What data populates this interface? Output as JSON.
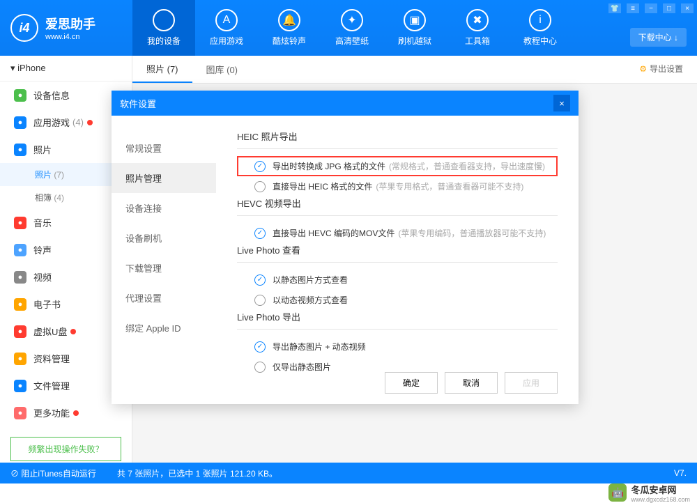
{
  "app": {
    "title": "爱思助手",
    "url": "www.i4.cn"
  },
  "nav": [
    {
      "label": "我的设备"
    },
    {
      "label": "应用游戏"
    },
    {
      "label": "酷炫铃声"
    },
    {
      "label": "高清壁纸"
    },
    {
      "label": "刷机越狱"
    },
    {
      "label": "工具箱"
    },
    {
      "label": "教程中心"
    }
  ],
  "download_center": "下载中心 ↓",
  "device": "iPhone",
  "sidebar": [
    {
      "label": "设备信息",
      "color": "#4cbf4c"
    },
    {
      "label": "应用游戏",
      "count": "(4)",
      "color": "#0a84ff",
      "dot": true
    },
    {
      "label": "照片",
      "color": "#0a84ff",
      "subs": [
        {
          "label": "照片",
          "count": "(7)",
          "active": true
        },
        {
          "label": "相簿",
          "count": "(4)"
        }
      ]
    },
    {
      "label": "音乐",
      "color": "#ff3b30"
    },
    {
      "label": "铃声",
      "color": "#4da3ff"
    },
    {
      "label": "视频",
      "color": "#888"
    },
    {
      "label": "电子书",
      "color": "#ffa500"
    },
    {
      "label": "虚拟U盘",
      "color": "#ff3b30",
      "dot": true
    },
    {
      "label": "资料管理",
      "color": "#ffa500"
    },
    {
      "label": "文件管理",
      "color": "#0a84ff"
    },
    {
      "label": "更多功能",
      "color": "#ff6b6b",
      "dot": true
    }
  ],
  "help": "频繁出现操作失败？",
  "tabs": [
    {
      "label": "照片 (7)",
      "active": true
    },
    {
      "label": "图库 (0)"
    }
  ],
  "export_settings": "导出设置",
  "dialog": {
    "title": "软件设置",
    "sidebar": [
      "常规设置",
      "照片管理",
      "设备连接",
      "设备刷机",
      "下载管理",
      "代理设置",
      "绑定 Apple ID"
    ],
    "sections": [
      {
        "title": "HEIC 照片导出",
        "options": [
          {
            "label": "导出时转换成 JPG 格式的文件",
            "hint": "(常规格式，普通查看器支持，导出速度慢)",
            "checked": true,
            "highlighted": true
          },
          {
            "label": "直接导出 HEIC 格式的文件",
            "hint": "(苹果专用格式，普通查看器可能不支持)"
          }
        ]
      },
      {
        "title": "HEVC 视频导出",
        "options": [
          {
            "label": "直接导出 HEVC 编码的MOV文件",
            "hint": "(苹果专用编码，普通播放器可能不支持)",
            "checked": true
          }
        ]
      },
      {
        "title": "Live Photo 查看",
        "options": [
          {
            "label": "以静态图片方式查看",
            "checked": true
          },
          {
            "label": "以动态视频方式查看"
          }
        ]
      },
      {
        "title": "Live Photo 导出",
        "options": [
          {
            "label": "导出静态图片 + 动态视频",
            "checked": true
          },
          {
            "label": "仅导出静态图片"
          }
        ]
      }
    ],
    "buttons": {
      "ok": "确定",
      "cancel": "取消",
      "apply": "应用"
    }
  },
  "status": {
    "left": "阻止iTunes自动运行",
    "mid": "共 7 张照片，已选中 1 张照片 121.20 KB。",
    "right": "V7."
  },
  "watermark": {
    "name": "冬瓜安卓网",
    "url": "www.dgxcdz168.com"
  }
}
